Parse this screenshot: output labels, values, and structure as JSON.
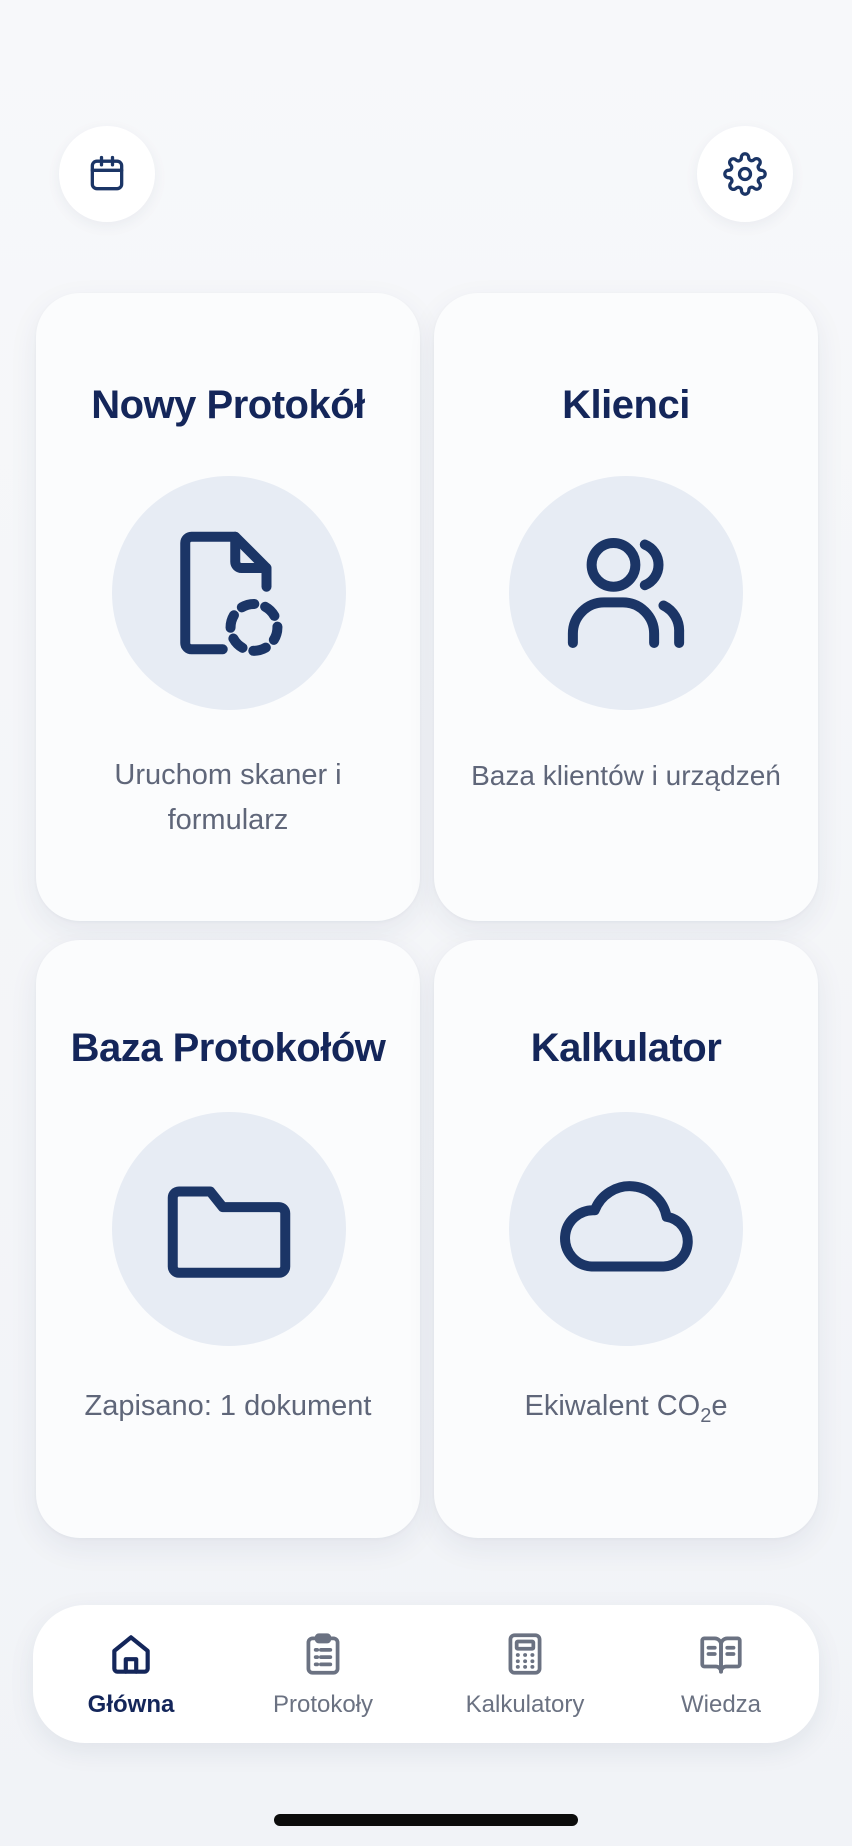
{
  "header": {
    "left_icon": "calendar-icon",
    "right_icon": "gear-icon"
  },
  "cards": [
    {
      "title": "Nowy Protokół",
      "subtitle": "Uruchom skaner i formularz",
      "icon": "document-scan-icon"
    },
    {
      "title": "Klienci",
      "subtitle": "Baza klientów i urządzeń",
      "icon": "users-icon"
    },
    {
      "title": "Baza Protokołów",
      "subtitle": "Zapisano: 1 dokument",
      "icon": "folder-icon"
    },
    {
      "title": "Kalkulator",
      "subtitle_prefix": "Ekiwalent CO",
      "subtitle_sub": "2",
      "subtitle_suffix": "e",
      "icon": "cloud-icon"
    }
  ],
  "tabbar": {
    "active": "Główna",
    "tabs": [
      {
        "label": "Główna",
        "icon": "home-icon"
      },
      {
        "label": "Protokoły",
        "icon": "clipboard-icon"
      },
      {
        "label": "Kalkulatory",
        "icon": "calculator-icon"
      },
      {
        "label": "Wiedza",
        "icon": "book-icon"
      }
    ]
  },
  "colors": {
    "primary": "#14265a",
    "icon_stroke": "#1b3566",
    "muted_text": "#5f6679",
    "icon_circle_bg": "#e7ecf4",
    "card_bg": "#fbfcfd"
  }
}
